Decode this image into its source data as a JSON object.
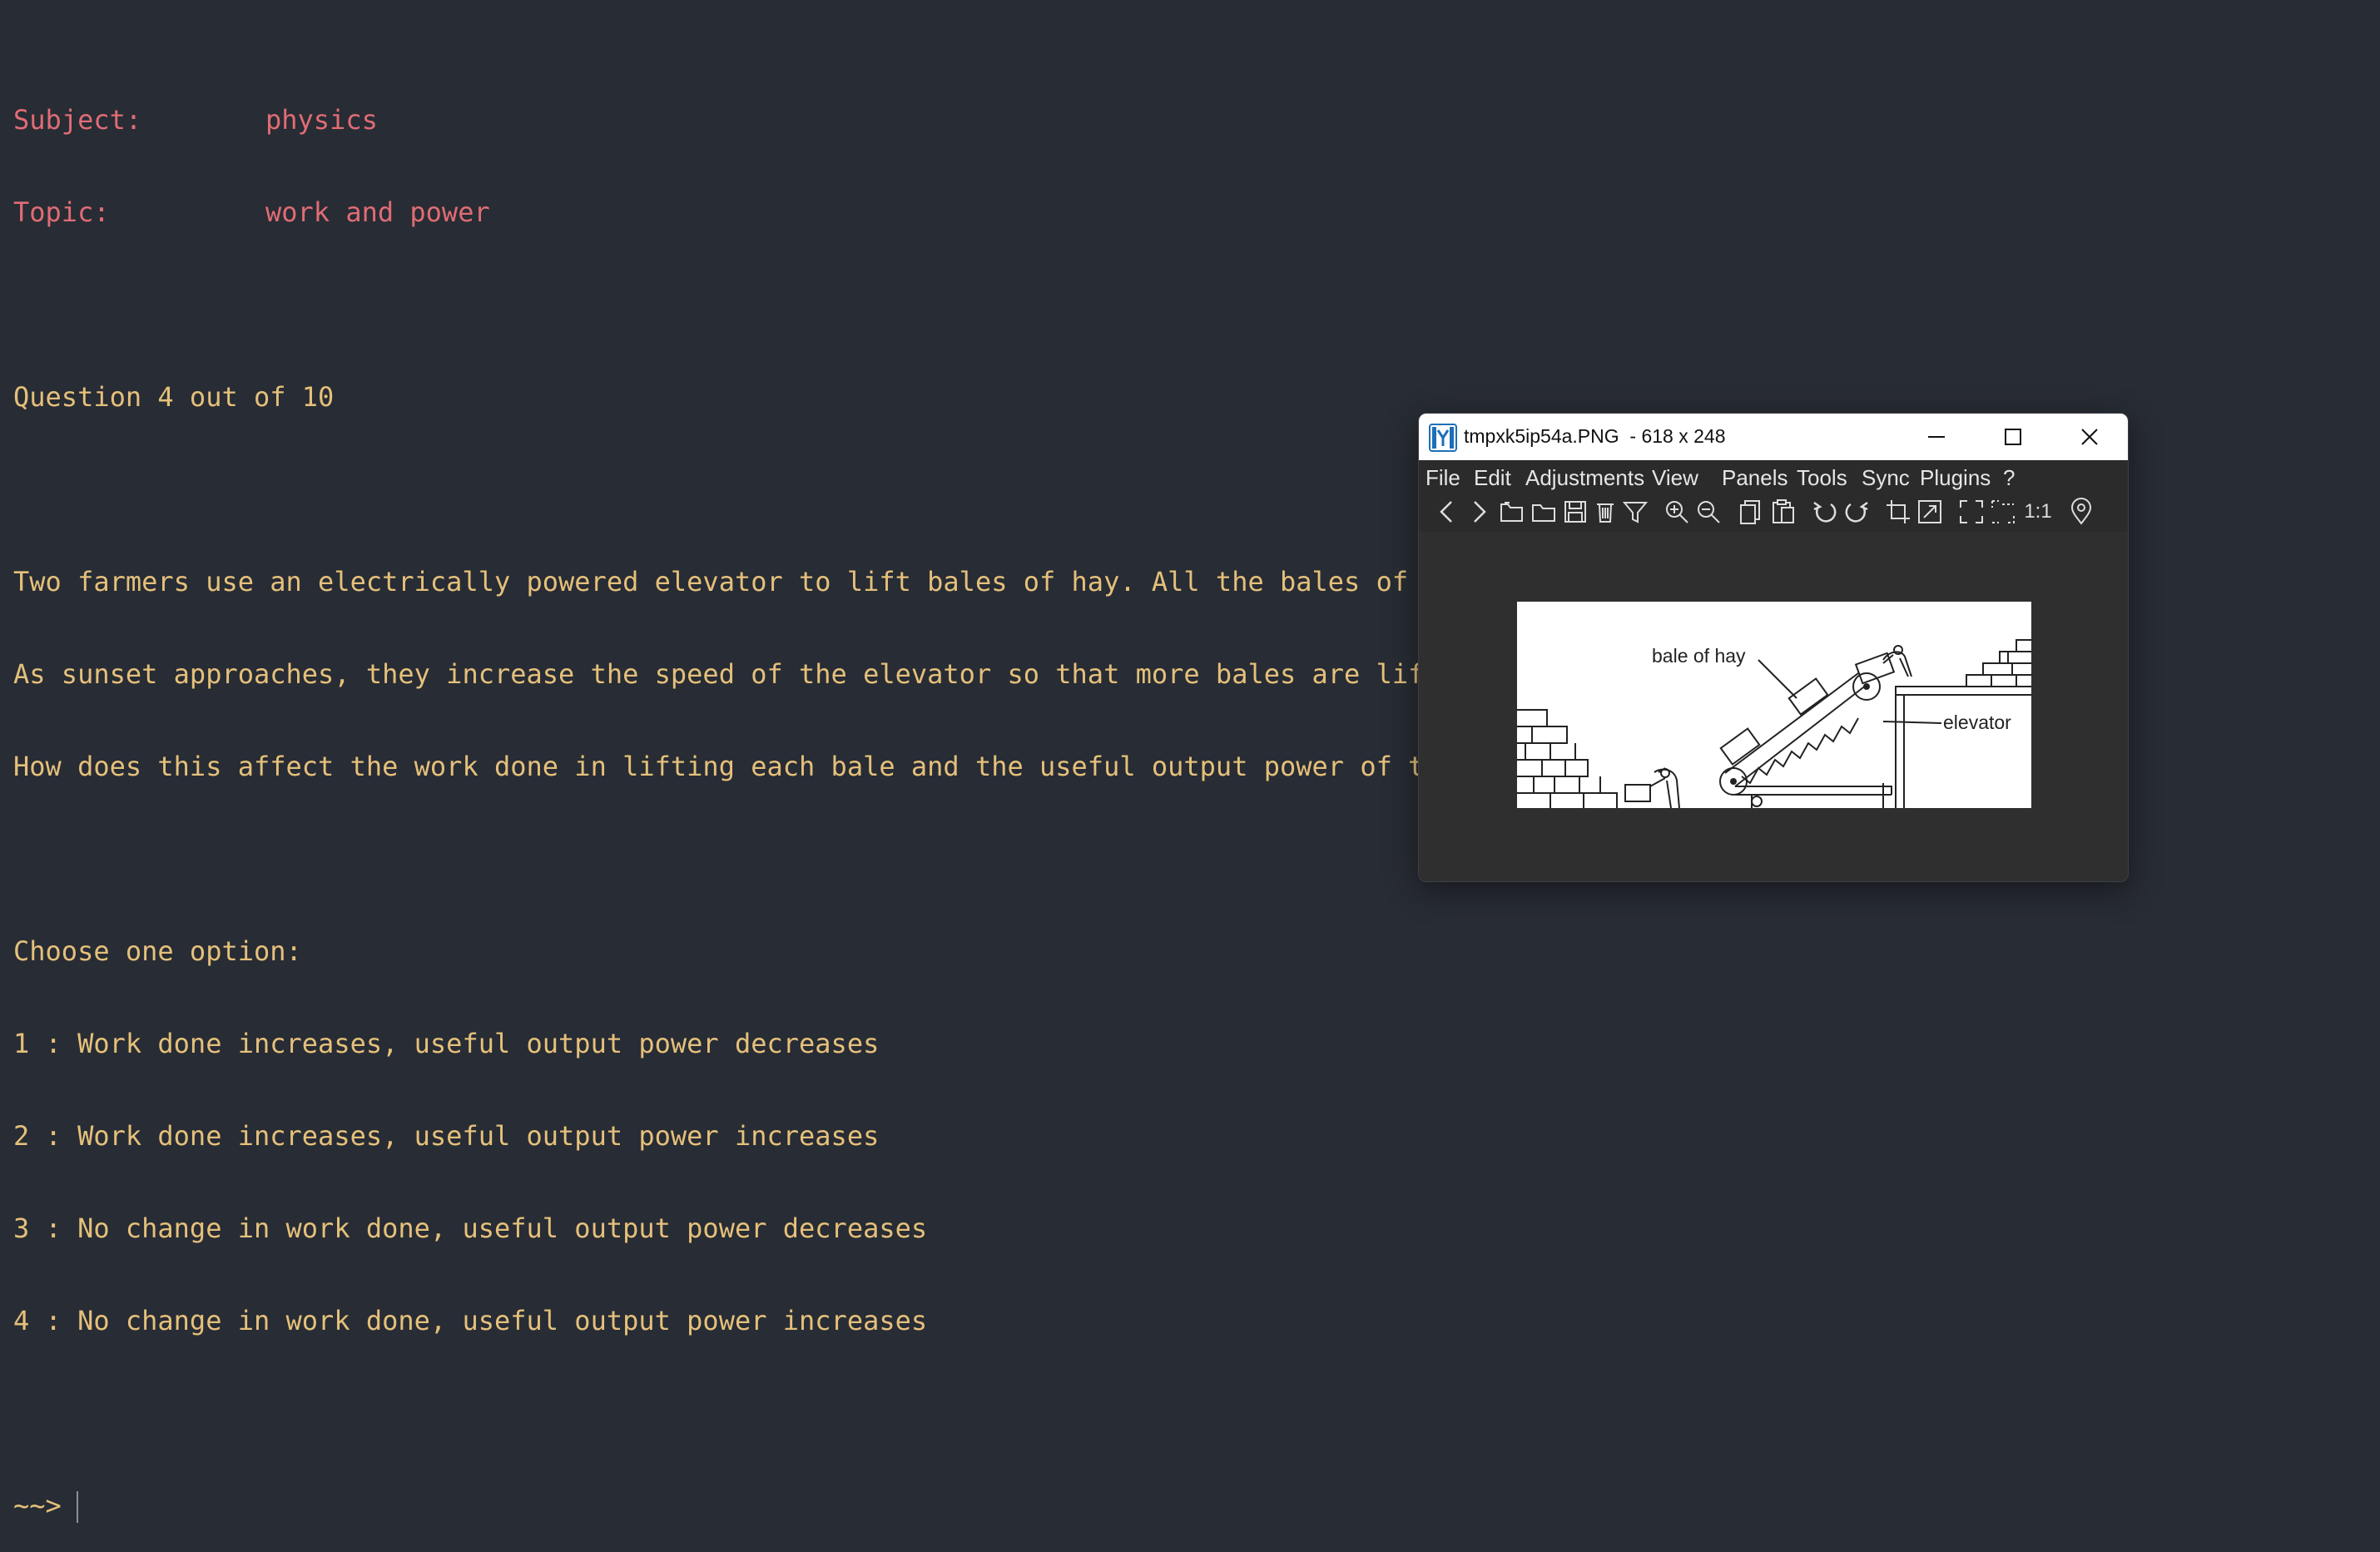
{
  "terminal": {
    "subject_label": "Subject:",
    "subject_value": "physics",
    "topic_label": "Topic:",
    "topic_value": "work and power",
    "question_counter": "Question 4 out of 10",
    "question_lines": [
      "Two farmers use an electrically powered elevator to lift bales of hay. All the bales of hay have the same mass.",
      "As sunset approaches, they increase the speed of the elevator so that more bales are lifted up in a given time.",
      "How does this affect the work done in lifting each bale and the useful output power of the elevator?"
    ],
    "choose_prompt": "Choose one option:",
    "options": [
      "1 : Work done increases, useful output power decreases",
      "2 : Work done increases, useful output power increases",
      "3 : No change in work done, useful output power decreases",
      "4 : No change in work done, useful output power increases"
    ],
    "prompt": "~~>"
  },
  "viewer": {
    "title": "tmpxk5ip54a.PNG  - 618 x 248",
    "menu": [
      "File",
      "Edit",
      "Adjustments",
      "View",
      "Panels",
      "Tools",
      "Sync",
      "Plugins",
      "?"
    ],
    "toolbar_icons": [
      "prev-icon",
      "next-icon",
      "open-folder-icon",
      "browse-folder-icon",
      "save-icon",
      "delete-icon",
      "filter-icon",
      "zoom-in-icon",
      "zoom-out-icon",
      "copy-icon",
      "paste-icon",
      "rotate-left-icon",
      "rotate-right-icon",
      "crop-icon",
      "resize-icon",
      "fit-screen-icon",
      "fullscreen-icon",
      "actual-size-icon",
      "location-pin-icon"
    ],
    "actual_size_label": "1:1",
    "image": {
      "label_bale": "bale of hay",
      "label_elevator": "elevator"
    }
  },
  "colors": {
    "background": "#282c34",
    "header_text": "#e06c75",
    "body_text": "#e5c07b"
  }
}
